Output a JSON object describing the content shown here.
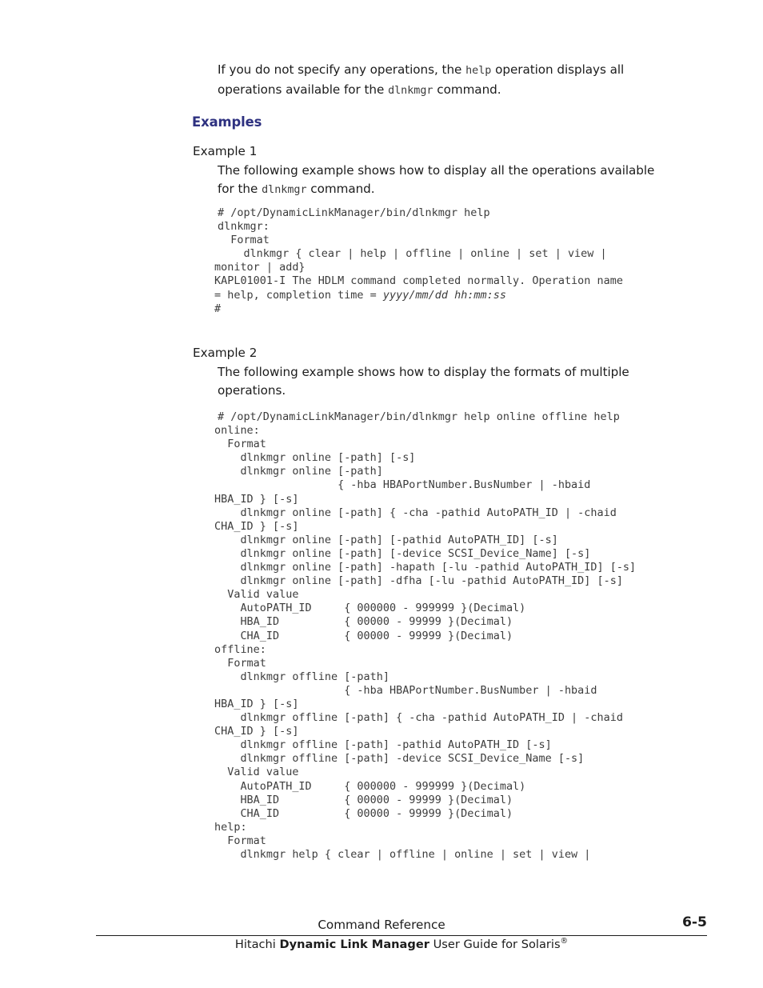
{
  "document": {
    "title": "Hitachi Dynamic Link Manager User Guide for Solaris",
    "heading_color": "#2e3180"
  },
  "intro": {
    "part1": "If you do not specify any operations, the ",
    "code1": "help",
    "part2": " operation displays all",
    "line2_part1": "operations available for the ",
    "line2_code": "dlnkmgr",
    "line2_part2": " command."
  },
  "sections": {
    "examples_heading": "Examples"
  },
  "example1": {
    "label": "Example 1",
    "desc_line1": "The following example shows how to display all the operations available",
    "desc_line2_part1": "for the ",
    "desc_line2_code": "dlnkmgr",
    "desc_line2_part2": " command.",
    "code_lines": [
      "# /opt/DynamicLinkManager/bin/dlnkmgr help",
      "dlnkmgr:",
      "  Format",
      "    dlnkmgr { clear | help | offline | online | set | view |",
      "monitor | add}",
      "KAPL01001-I The HDLM command completed normally. Operation name",
      "= help, completion time = ",
      "#"
    ],
    "code_italic_timestamp": "yyyy/mm/dd hh:mm:ss"
  },
  "example2": {
    "label": "Example 2",
    "desc_line1": "The following example shows how to display the formats of multiple",
    "desc_line2": "operations.",
    "code_lines": [
      "# /opt/DynamicLinkManager/bin/dlnkmgr help online offline help",
      "online:",
      "  Format",
      "    dlnkmgr online [-path] [-s]",
      "    dlnkmgr online [-path]",
      "                   { -hba HBAPortNumber.BusNumber | -hbaid",
      "HBA_ID } [-s]",
      "    dlnkmgr online [-path] { -cha -pathid AutoPATH_ID | -chaid",
      "CHA_ID } [-s]",
      "    dlnkmgr online [-path] [-pathid AutoPATH_ID] [-s]",
      "    dlnkmgr online [-path] [-device SCSI_Device_Name] [-s]",
      "    dlnkmgr online [-path] -hapath [-lu -pathid AutoPATH_ID] [-s]",
      "    dlnkmgr online [-path] -dfha [-lu -pathid AutoPATH_ID] [-s]",
      "  Valid value",
      "    AutoPATH_ID     { 000000 - 999999 }(Decimal)",
      "    HBA_ID          { 00000 - 99999 }(Decimal)",
      "    CHA_ID          { 00000 - 99999 }(Decimal)",
      "offline:",
      "  Format",
      "    dlnkmgr offline [-path]",
      "                    { -hba HBAPortNumber.BusNumber | -hbaid",
      "HBA_ID } [-s]",
      "    dlnkmgr offline [-path] { -cha -pathid AutoPATH_ID | -chaid",
      "CHA_ID } [-s]",
      "    dlnkmgr offline [-path] -pathid AutoPATH_ID [-s]",
      "    dlnkmgr offline [-path] -device SCSI_Device_Name [-s]",
      "  Valid value",
      "    AutoPATH_ID     { 000000 - 999999 }(Decimal)",
      "    HBA_ID          { 00000 - 99999 }(Decimal)",
      "    CHA_ID          { 00000 - 99999 }(Decimal)",
      "help:",
      "  Format",
      "    dlnkmgr help { clear | offline | online | set | view |"
    ]
  },
  "footer": {
    "chapter_title": "Command Reference",
    "page_number": "6-5",
    "guide_prefix": "Hitachi ",
    "guide_bold": "Dynamic Link Manager",
    "guide_suffix": " User Guide for Solaris",
    "guide_registered_mark": "®"
  }
}
